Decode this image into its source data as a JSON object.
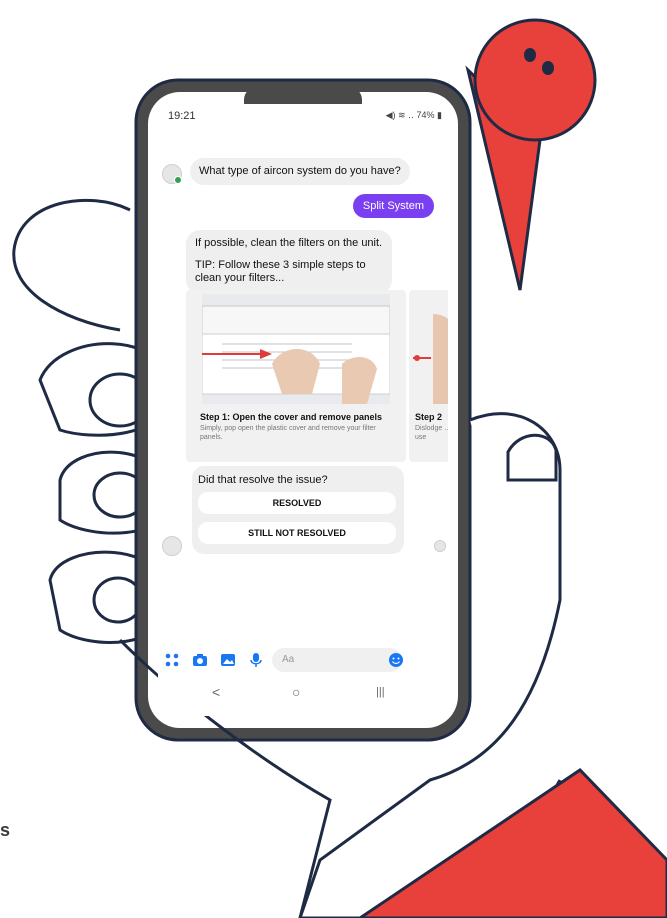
{
  "status_bar": {
    "time": "19:21",
    "indicators": "◀)  ≋  ‥ 74% ▮",
    "battery": "74%"
  },
  "chat": {
    "question": "What type of aircon system do you have?",
    "user_reply": "Split System",
    "tip_line1": "If possible, clean the filters on the unit.",
    "tip_line2": "TIP: Follow these 3 simple steps to clean your filters...",
    "cards": [
      {
        "title": "Step 1: Open the cover and remove panels",
        "desc": "Simply, pop open the plastic cover and remove your filter panels."
      },
      {
        "title": "Step 2",
        "desc": "Dislodge … can use"
      }
    ],
    "resolve_question": "Did that resolve the issue?",
    "resolved_label": "RESOLVED",
    "not_resolved_label": "STILL NOT RESOLVED"
  },
  "composer": {
    "placeholder": "Aa",
    "icons": [
      "apps-icon",
      "camera-icon",
      "image-icon",
      "mic-icon",
      "emoji-icon"
    ]
  },
  "navbar": {
    "back": "<",
    "home": "○",
    "recents": "|||"
  },
  "colors": {
    "accent": "#7b3ff2",
    "brand_red": "#e8403b",
    "outline": "#1f2a44",
    "phone_frame": "#4a4a4a"
  },
  "side_text": "s"
}
